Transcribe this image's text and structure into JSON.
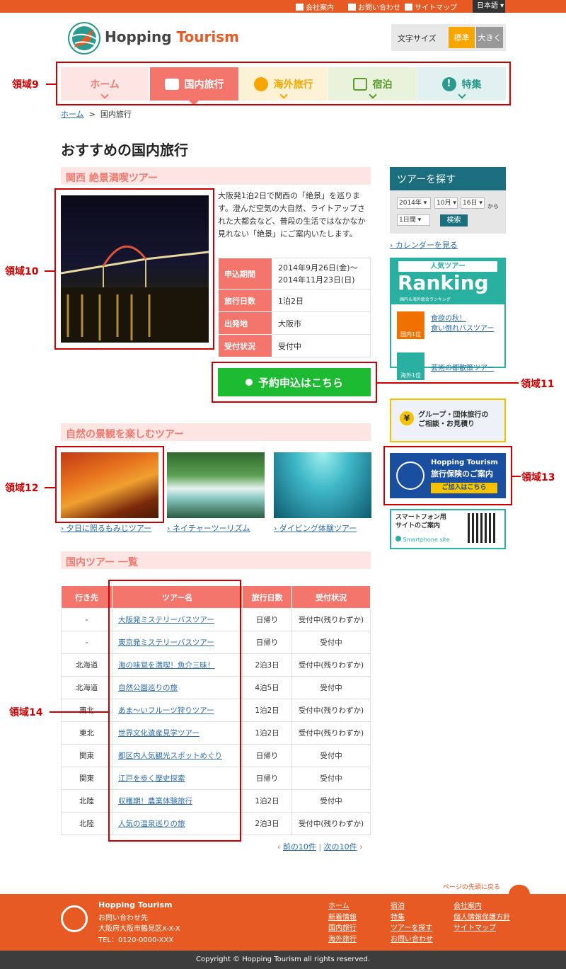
{
  "topbar": {
    "company": "会社案内",
    "contact": "お問い合わせ",
    "sitemap": "サイトマップ",
    "language": "日本語"
  },
  "header": {
    "logo_main": "Hopping ",
    "logo_accent": "Tourism",
    "fontsize_label": "文字サイズ",
    "fontsize_standard": "標準",
    "fontsize_large": "大きく"
  },
  "nav": {
    "home": "ホーム",
    "domestic": "国内旅行",
    "overseas": "海外旅行",
    "stay": "宿泊",
    "special": "特集"
  },
  "annotations": {
    "a9": "領域9",
    "a10": "領域10",
    "a11": "領域11",
    "a12": "領域12",
    "a13": "領域13",
    "a14": "領域14"
  },
  "breadcrumb": {
    "home": "ホーム",
    "sep": ">",
    "current": "国内旅行"
  },
  "page_title": "おすすめの国内旅行",
  "feature": {
    "heading": "関西 絶景満喫ツアー",
    "description": "大阪発1泊2日で関西の「絶景」を巡ります。澄んだ空気の大自然、ライトアップされた大都会など、普段の生活ではなかなか見れない「絶景」にご案内いたします。",
    "rows": [
      {
        "label": "申込期間",
        "value": "2014年9月26日(金)〜\n2014年11月23日(日)"
      },
      {
        "label": "旅行日数",
        "value": "1泊2日"
      },
      {
        "label": "出発地",
        "value": "大阪市"
      },
      {
        "label": "受付状況",
        "value": "受付中"
      }
    ],
    "apply_button": "予約申込はこちら"
  },
  "nature": {
    "heading": "自然の景観を楽しむツアー",
    "items": [
      "夕日に照るもみじツアー",
      "ネイチャーツーリズム",
      "ダイビング体験ツアー"
    ]
  },
  "list": {
    "heading": "国内ツアー 一覧",
    "headers": [
      "行き先",
      "ツアー名",
      "旅行日数",
      "受付状況"
    ],
    "rows": [
      [
        "-",
        "大阪発ミステリーバスツアー",
        "日帰り",
        "受付中(残りわずか)"
      ],
      [
        "-",
        "東京発ミステリーバスツアー",
        "日帰り",
        "受付中"
      ],
      [
        "北海道",
        "海の味覚を満喫！魚介三昧！",
        "2泊3日",
        "受付中(残りわずか)"
      ],
      [
        "北海道",
        "自然公園巡りの旅",
        "4泊5日",
        "受付中"
      ],
      [
        "東北",
        "あま〜いフルーツ狩りツアー",
        "1泊2日",
        "受付中(残りわずか)"
      ],
      [
        "東北",
        "世界文化遺産見学ツアー",
        "1泊2日",
        "受付中(残りわずか)"
      ],
      [
        "関東",
        "都区内人気観光スポットめぐり",
        "日帰り",
        "受付中"
      ],
      [
        "関東",
        "江戸を歩く歴史探索",
        "日帰り",
        "受付中"
      ],
      [
        "北陸",
        "収穫期！農業体験旅行",
        "1泊2日",
        "受付中"
      ],
      [
        "北陸",
        "人気の温泉巡りの旅",
        "2泊3日",
        "受付中(残りわずか)"
      ]
    ],
    "prev": "前の10件",
    "sep": "|",
    "next": "次の10件"
  },
  "sidebar": {
    "search_title": "ツアーを探す",
    "year": "2014年",
    "month": "10月",
    "day": "16日",
    "from": "から",
    "duration": "1日間",
    "search_button": "検索",
    "calendar_link": "カレンダーを見る",
    "ranking_label": "人気ツアー",
    "ranking_title": "Ranking",
    "ranking_sub": "国内＆海外総合ランキング",
    "rank1_badge": "国内1位",
    "rank1_text": "食欲の秋！\n食い倒れバスツアー",
    "rank2_badge": "海外1位",
    "rank2_text": "芸術の都散策ツアー",
    "group_text": "グループ・団体旅行の\nご相談・お見積り",
    "yen": "¥",
    "ins_title": "Hopping Tourism",
    "ins_sub": "旅行保険のご案内",
    "ins_btn": "ご加入はこちら",
    "sp_title": "スマートフォン用\nサイトのご案内",
    "sp_sub": "Smartphone site"
  },
  "footer": {
    "back_to_top": "ページの先頭に戻る",
    "name": "Hopping Tourism",
    "contact": "お問い合わせ先",
    "address": "大阪府大阪市鶴見区X-X-X",
    "tel": "TEL：0120-0000-XXX",
    "col1": [
      "ホーム",
      "新着情報",
      "国内旅行",
      "海外旅行"
    ],
    "col2": [
      "宿泊",
      "特集",
      "ツアーを探す",
      "お問い合わせ"
    ],
    "col3": [
      "会社案内",
      "個人情報保護方針",
      "サイトマップ"
    ],
    "copyright": "Copyright © Hopping  Tourism all rights reserved."
  },
  "colors": {
    "brand": "#e85a23",
    "salmon": "#f3756b",
    "green": "#1dbb31",
    "teal": "#1a6e7e"
  }
}
